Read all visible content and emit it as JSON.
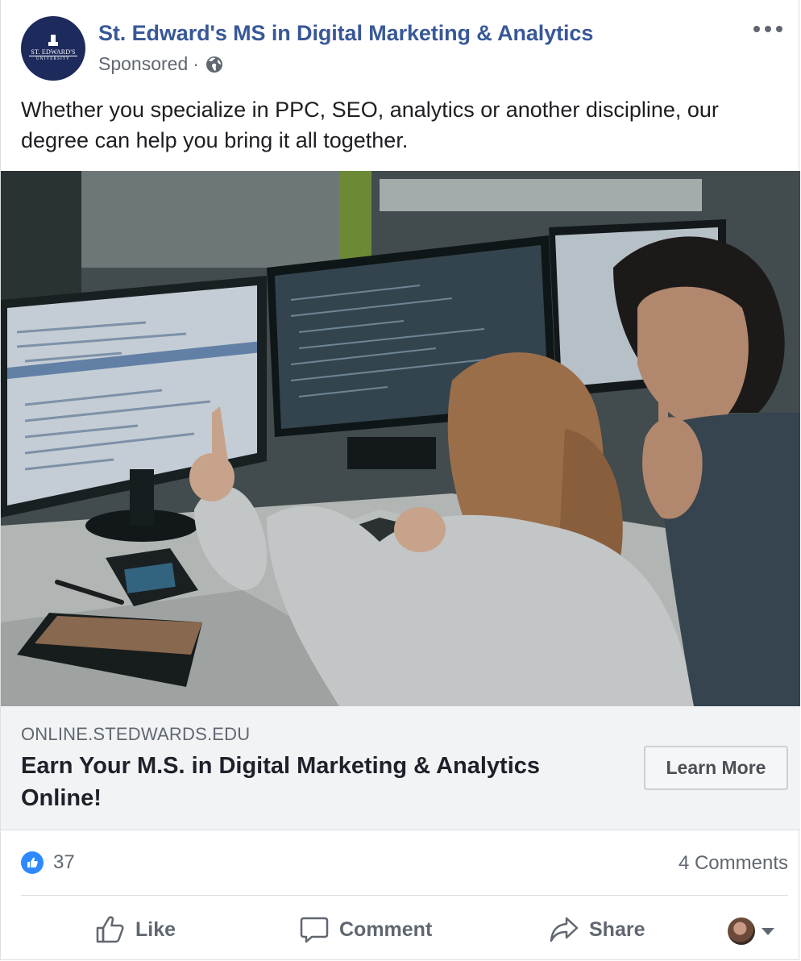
{
  "post": {
    "page_name": "St. Edward's MS in Digital Marketing & Analytics",
    "avatar_wordmark_top": "ST. EDWARD'S",
    "avatar_wordmark_bottom": "UNIVERSITY",
    "sponsored_label": "Sponsored",
    "separator": "·",
    "privacy_icon": "globe-icon",
    "more_icon": "more-options-icon",
    "body_text": "Whether you specialize in PPC, SEO, analytics or another discipline, our degree can help you bring it all together."
  },
  "link_preview": {
    "domain": "ONLINE.STEDWARDS.EDU",
    "headline": "Earn Your M.S. in Digital Marketing & Analytics Online!",
    "cta_label": "Learn More"
  },
  "engagement": {
    "reaction_icon": "like-reaction-icon",
    "like_count": "37",
    "comments_label": "4 Comments"
  },
  "actions": {
    "like_label": "Like",
    "comment_label": "Comment",
    "share_label": "Share",
    "like_icon": "thumbs-up-icon",
    "comment_icon": "speech-bubble-icon",
    "share_icon": "share-arrow-icon",
    "profile_selector_icon": "chevron-down-icon"
  },
  "colors": {
    "page_name": "#385898",
    "secondary_text": "#606770",
    "link_box_bg": "#f2f3f5",
    "like_blue": "#2e89ff",
    "avatar_navy": "#1d2a5c"
  }
}
